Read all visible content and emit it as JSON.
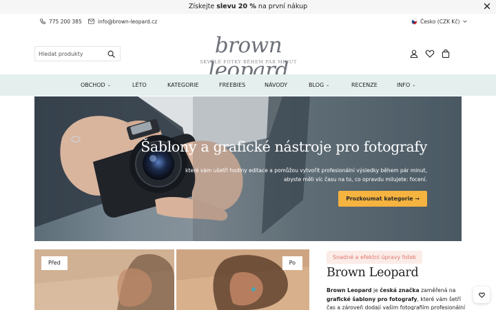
{
  "promo": {
    "prefix": "Získejte",
    "bold": "slevu 20 %",
    "suffix": "na první nákup"
  },
  "contact": {
    "phone": "775 200 385",
    "email": "info@brown-leopard.cz"
  },
  "locale": {
    "label": "Česko (CZK Kč)"
  },
  "search": {
    "placeholder": "Hledat produkty",
    "value": ""
  },
  "logo": {
    "script": "brown leopard",
    "tagline": "SKVĚLÉ FOTKY BĚHEM PÁR MINUT"
  },
  "nav": {
    "items": [
      {
        "label": "OBCHOD",
        "dropdown": true
      },
      {
        "label": "LÉTO",
        "dropdown": false
      },
      {
        "label": "KATEGORIE",
        "dropdown": false
      },
      {
        "label": "FREEBIES",
        "dropdown": false
      },
      {
        "label": "NÁVODY",
        "dropdown": false
      },
      {
        "label": "BLOG",
        "dropdown": true
      },
      {
        "label": "RECENZE",
        "dropdown": false
      },
      {
        "label": "INFO",
        "dropdown": true
      }
    ]
  },
  "hero": {
    "title": "Šablony a grafické nástroje pro fotografy",
    "subtitle_line1": "které vám ušetří hodiny editace a pomůžou vytvořit profesionální výsledky během pár minut,",
    "subtitle_line2": "abyste měli víc času na to, co opravdu milujete: focení.",
    "cta": "Prozkoumat kategorie →"
  },
  "compare": {
    "before": "Před",
    "after": "Po"
  },
  "about": {
    "badge": "Snadné a efektní úpravy fotek",
    "title": "Brown Leopard",
    "p_brand": "Brown Leopard",
    "p_t1": " je ",
    "p_b2": "česká značka",
    "p_t2": " zaměřená na ",
    "p_b3": "grafické šablony pro fotografy",
    "p_t3": ", které vám šetří čas a zároveň dodají vašim fotografiím profesionální"
  },
  "colors": {
    "nav_bg": "#e5efed",
    "cta": "#f5b33f",
    "badge_text": "#e2766c",
    "badge_bg": "#fbece8"
  },
  "icons": [
    "phone-icon",
    "mail-icon",
    "search-icon",
    "user-icon",
    "heart-icon",
    "bag-icon",
    "close-icon",
    "chevron-down-icon",
    "chat-heart-icon"
  ]
}
